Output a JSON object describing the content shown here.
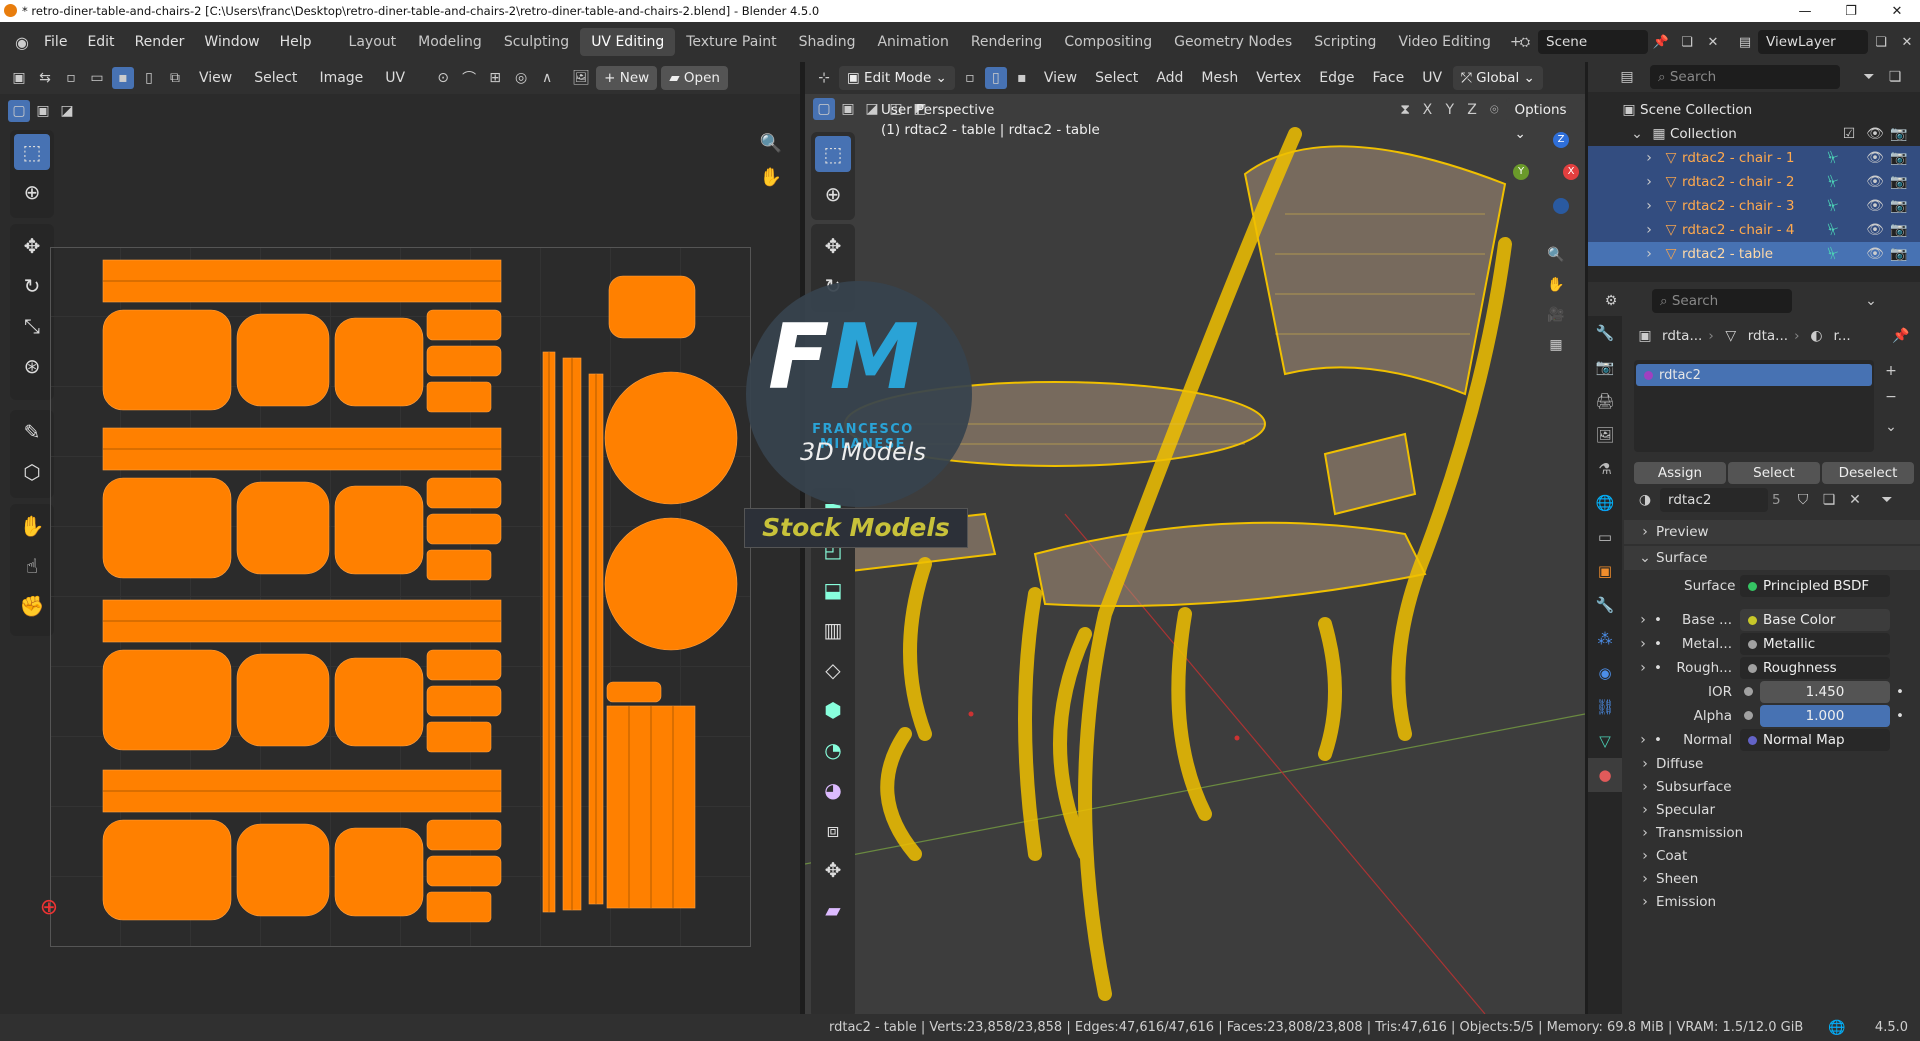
{
  "titlebar": {
    "title": "* retro-diner-table-and-chairs-2 [C:\\Users\\franc\\Desktop\\retro-diner-table-and-chairs-2\\retro-diner-table-and-chairs-2.blend] - Blender 4.5.0",
    "minimize": "—",
    "maximize": "❐",
    "close": "✕"
  },
  "menu": [
    "File",
    "Edit",
    "Render",
    "Window",
    "Help"
  ],
  "workspaces": [
    "Layout",
    "Modeling",
    "Sculpting",
    "UV Editing",
    "Texture Paint",
    "Shading",
    "Animation",
    "Rendering",
    "Compositing",
    "Geometry Nodes",
    "Scripting",
    "Video Editing"
  ],
  "active_workspace": "UV Editing",
  "workspace_add": "+",
  "scene": "Scene",
  "view_layer": "ViewLayer",
  "uv_editor": {
    "menus": [
      "View",
      "Select",
      "Image",
      "UV"
    ],
    "new_label": "New",
    "open_label": "Open"
  },
  "viewport": {
    "mode": "Edit Mode",
    "menus": [
      "View",
      "Select",
      "Add",
      "Mesh",
      "Vertex",
      "Edge",
      "Face",
      "UV"
    ],
    "orientation": "Global",
    "axes": [
      "X",
      "Y",
      "Z"
    ],
    "options": "Options",
    "perspective_label": "User Perspective",
    "object_label": "(1) rdtac2 - table | rdtac2 - table",
    "gizmo_axes": [
      "Z",
      "X",
      "Y"
    ]
  },
  "watermark": {
    "logo": "FM",
    "brand": "FRANCESCO MILANESE",
    "tagline": "3D Models",
    "badge": "Stock Models"
  },
  "outliner": {
    "search_placeholder": "Search",
    "scene_collection": "Scene Collection",
    "collection": "Collection",
    "objects": [
      "rdtac2 - chair - 1",
      "rdtac2 - chair - 2",
      "rdtac2 - chair - 3",
      "rdtac2 - chair - 4",
      "rdtac2 - table"
    ]
  },
  "properties": {
    "search_placeholder": "Search",
    "breadcrumb": [
      "rdta...",
      "rdta...",
      "r..."
    ],
    "material_slot": "rdtac2",
    "assign": "Assign",
    "select": "Select",
    "deselect": "Deselect",
    "material_name": "rdtac2",
    "material_users": "5",
    "preview": "Preview",
    "surface_panel": "Surface",
    "surface_label": "Surface",
    "surface_value": "Principled BSDF",
    "inputs": [
      {
        "label": "Base ...",
        "value": "Base Color",
        "color": "#c7c729"
      },
      {
        "label": "Metal...",
        "value": "Metallic",
        "color": "#a1a1a1"
      },
      {
        "label": "Rough...",
        "value": "Roughness",
        "color": "#a1a1a1"
      }
    ],
    "ior_label": "IOR",
    "ior_value": "1.450",
    "alpha_label": "Alpha",
    "alpha_value": "1.000",
    "normal_label": "Normal",
    "normal_value": "Normal Map",
    "subpanels": [
      "Diffuse",
      "Subsurface",
      "Specular",
      "Transmission",
      "Coat",
      "Sheen",
      "Emission"
    ]
  },
  "statusbar": {
    "text": "rdtac2 - table | Verts:23,858/23,858 | Edges:47,616/47,616 | Faces:23,808/23,808 | Tris:47,616 | Objects:5/5 | Memory: 69.8 MiB | VRAM: 1.5/12.0 GiB",
    "version": "4.5.0"
  },
  "colors": {
    "accent": "#4772b3",
    "uv_orange": "#ff8000",
    "wire_yellow": "#f0c000",
    "object_orange": "#ffa94d"
  }
}
